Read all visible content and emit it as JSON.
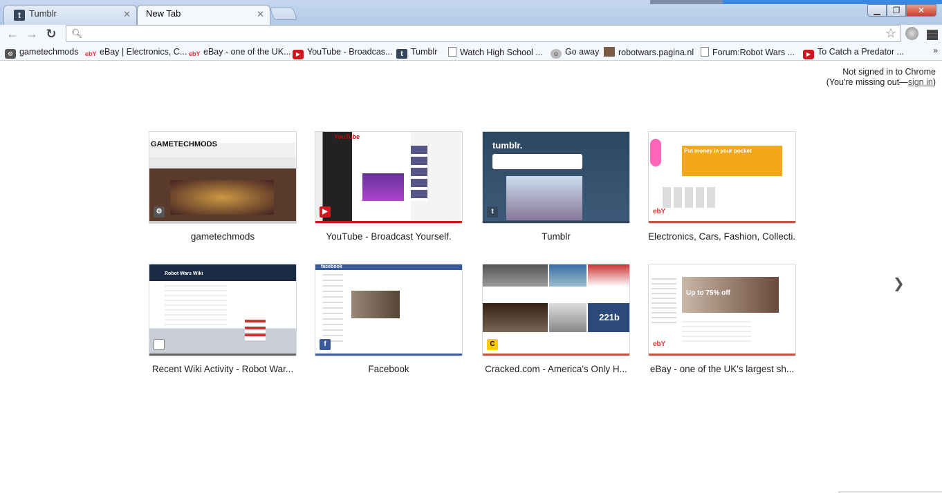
{
  "tabs": [
    {
      "title": "Tumblr",
      "favicon": "tumblr-icon",
      "active": false
    },
    {
      "title": "New Tab",
      "active": true
    }
  ],
  "window_controls": {
    "minimize": "▁",
    "maximize": "❐",
    "close": "✕"
  },
  "omnibox": {
    "value": "",
    "placeholder": ""
  },
  "bookmarks": [
    {
      "label": "gametechmods",
      "icon": "gear-icon"
    },
    {
      "label": "eBay | Electronics, C...",
      "icon": "ebay-icon"
    },
    {
      "label": "eBay - one of the UK...",
      "icon": "ebay-icon"
    },
    {
      "label": "YouTube - Broadcas...",
      "icon": "youtube-icon"
    },
    {
      "label": "Tumblr",
      "icon": "tumblr-icon"
    },
    {
      "label": "Watch High School ...",
      "icon": "page-icon"
    },
    {
      "label": "Go away",
      "icon": "face-icon"
    },
    {
      "label": "robotwars.pagina.nl",
      "icon": "image-icon"
    },
    {
      "label": "Forum:Robot Wars ...",
      "icon": "page-icon"
    },
    {
      "label": "To Catch a Predator ...",
      "icon": "youtube-icon"
    }
  ],
  "bookmarks_more": "»",
  "signin": {
    "line1": "Not signed in to Chrome",
    "line2_prefix": "(You're missing out—",
    "link": "sign in",
    "line2_suffix": ")"
  },
  "most_visited": [
    {
      "title": "gametechmods",
      "thumb_text": "GAMETECHMODS",
      "badge": "gear-icon",
      "accent": "#cccccc"
    },
    {
      "title": "YouTube - Broadcast Yourself.",
      "thumb_text": "YouTube",
      "badge": "youtube-icon",
      "accent": "#cc181e"
    },
    {
      "title": "Tumblr",
      "thumb_text": "tumblr.",
      "badge": "tumblr-icon",
      "accent": "#36465d"
    },
    {
      "title": "Electronics, Cars, Fashion, Collecti...",
      "thumb_text": "Put money in your pocket",
      "badge": "ebay-icon",
      "accent": "#c8553d"
    },
    {
      "title": "Recent Wiki Activity - Robot War...",
      "thumb_text": "Robot Wars Wiki",
      "badge": "page-icon",
      "accent": "#666666"
    },
    {
      "title": "Facebook",
      "thumb_text": "facebook",
      "badge": "facebook-icon",
      "accent": "#3b5998"
    },
    {
      "title": "Cracked.com - America's Only H...",
      "thumb_text": "221b",
      "badge": "cracked-icon",
      "accent": "#c8553d"
    },
    {
      "title": "eBay - one of the UK's largest sh...",
      "thumb_text": "Up to 75% off",
      "badge": "ebay-icon",
      "accent": "#c8553d"
    }
  ],
  "next_page": "❯"
}
